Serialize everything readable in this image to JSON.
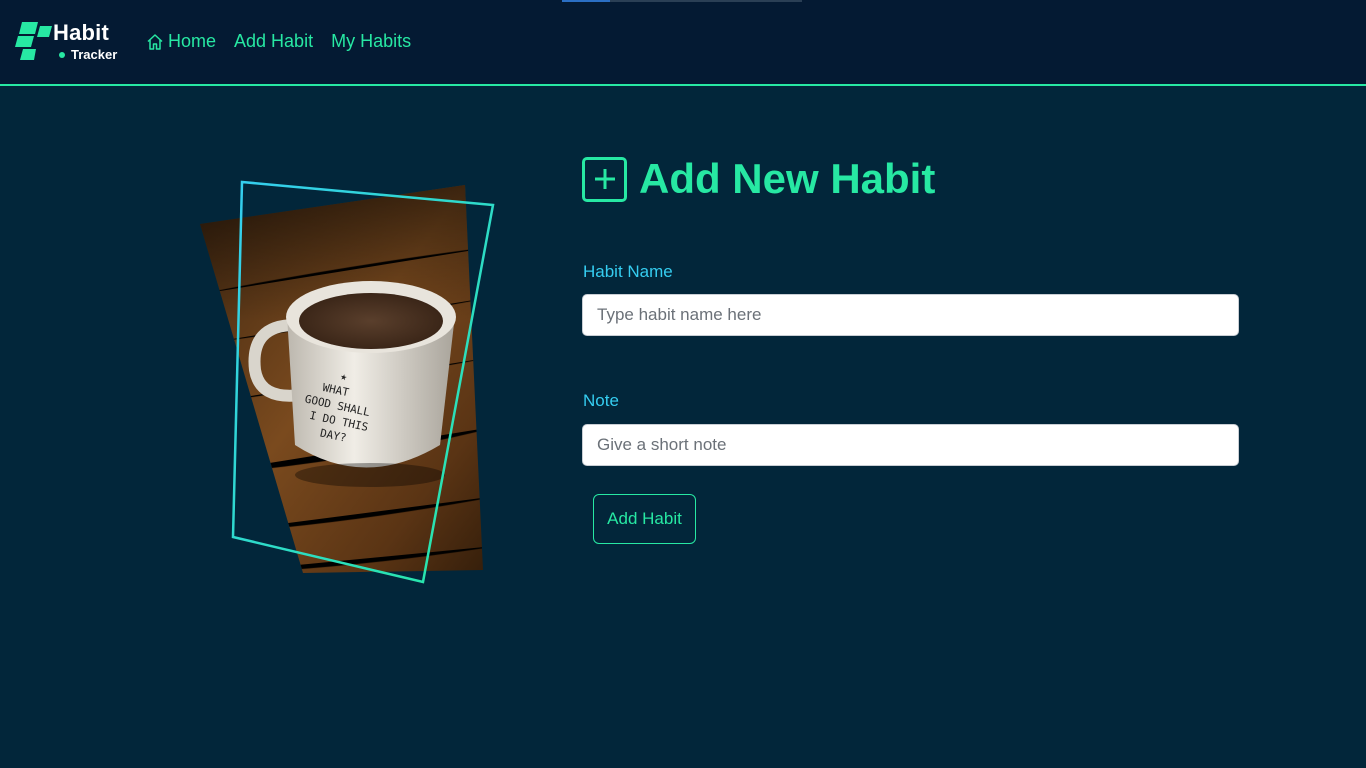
{
  "brand": {
    "title": "Habit",
    "subtitle": "Tracker",
    "logo_icon": "habit-tracker-logo-icon"
  },
  "nav": {
    "items": [
      {
        "label": "Home",
        "icon": "home-icon"
      },
      {
        "label": "Add Habit"
      },
      {
        "label": "My Habits"
      }
    ]
  },
  "page_load_progress": 0.2,
  "hero_image": {
    "description_icon": "coffee-mug-photo",
    "mug_text": "WHAT GOOD SHALL I DO THIS DAY?"
  },
  "form": {
    "title": "Add New Habit",
    "title_icon": "plus-square-icon",
    "fields": [
      {
        "label": "Habit Name",
        "value": "",
        "placeholder": "Type habit name here"
      },
      {
        "label": "Note",
        "value": "",
        "placeholder": "Give a short note"
      }
    ],
    "submit_label": "Add Habit"
  },
  "colors": {
    "background": "#02263a",
    "navbar": "#041a33",
    "accent_green": "#27e8a3",
    "label_cyan": "#35cdf0"
  }
}
